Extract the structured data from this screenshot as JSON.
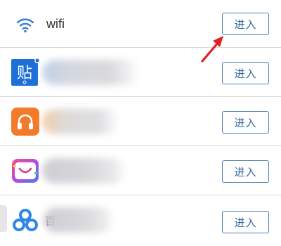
{
  "list": {
    "rows": [
      {
        "title": "wifi",
        "icon": "wifi-icon",
        "button_label": "进入"
      },
      {
        "title": "",
        "icon": "tieba-app-icon",
        "button_label": "进入",
        "icon_text": "贴"
      },
      {
        "title": "",
        "icon": "headphones-app-icon",
        "button_label": "进入"
      },
      {
        "title": "",
        "icon": "shopping-bag-app-icon",
        "button_label": "进入"
      },
      {
        "title": "",
        "icon": "baidu-netdisk-app-icon",
        "button_label": "进入",
        "partial_text": "百"
      }
    ]
  },
  "annotation": {
    "type": "red-arrow",
    "color": "#e02020",
    "points_to": "wifi enter button"
  },
  "colors": {
    "button_border": "#4a80b9",
    "button_text": "#2f63a0",
    "tieba_blue": "#1e6fd6",
    "headphones_orange": "#f27a2a",
    "divider": "#d8d8d8"
  }
}
